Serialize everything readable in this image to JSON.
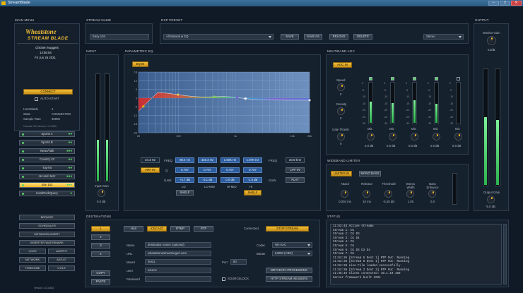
{
  "window": {
    "title": "StreamBlade",
    "minimize": "–",
    "maximize": "□",
    "close": "✕"
  },
  "main_menu": {
    "title": "MAIN MENU",
    "logo": "Wheatstone",
    "product": "STREAM BLADE",
    "station": "Chicken Nuggets",
    "time": "13:56:54",
    "date": "Fri Jun 25 2021",
    "connect_label": "CONNECT",
    "autostart_label": "AUTO-START",
    "host_label": "Host Blade",
    "host_value": "4",
    "state_label": "State",
    "state_value": "CONNECTED",
    "rate_label": "Sample Rate",
    "rate_value": "96000",
    "versions": "Console GUI Version 1.0.3.883",
    "sources": [
      {
        "label": "Sports A",
        "dots": "●●",
        "active": false
      },
      {
        "label": "Sports B",
        "dots": "●●",
        "active": false
      },
      {
        "label": "News/Talk",
        "dots": "●●●",
        "active": false
      },
      {
        "label": "Country 22",
        "dots": "●●",
        "active": false
      },
      {
        "label": "Top-hit",
        "dots": "●●",
        "active": false
      },
      {
        "label": "Jet and Jazz",
        "dots": "●●●",
        "active": false
      },
      {
        "label": "Site 103",
        "dots": "●●●",
        "active": true
      },
      {
        "label": "HardRockQuery",
        "dots": "●",
        "active": false
      }
    ],
    "buttons": [
      [
        "BROWSE"
      ],
      [
        "SCHEDULER"
      ],
      [
        "METADATA INSERT"
      ],
      [
        "INSERTER WATERMARK"
      ],
      [
        "LOGS",
        "ALERTS"
      ],
      [
        "NETWORK",
        "AES-67"
      ],
      [
        "TIMEZONE",
        "UTILS"
      ]
    ],
    "footer": "Version 1.0.3.883"
  },
  "stream_name": {
    "title": "STREAM NAME",
    "value": "Easy 103"
  },
  "dsp_preset": {
    "title": "DSP PRESET",
    "value": "All Natural w EQ",
    "save": "SAVE",
    "save_as": "SAVE AS",
    "reload": "RELOAD",
    "delete": "DELETE",
    "mode": "Stereo"
  },
  "output": {
    "title": "OUTPUT",
    "monitor_gain_label": "Monitor Gain",
    "monitor_gain_value": "-13dB",
    "output_gain_label": "Output Gain",
    "output_gain_value": "-5.0 dB",
    "level": 0.58
  },
  "input": {
    "title": "INPUT",
    "gain_label": "Input Gain",
    "gain_value": "0.0 dB",
    "level": 0.38
  },
  "eq": {
    "title": "PARAMETRIC EQ",
    "eq_in": "EQ IN",
    "db_ticks": [
      "18",
      "12",
      "6",
      "0",
      "-6",
      "-12",
      "-18",
      "-24"
    ],
    "freq_ticks": [
      "20",
      "100",
      "1k",
      "10k",
      "20k"
    ],
    "freq_label": "FREQ",
    "q_label": "Q",
    "gain_label": "GAIN",
    "hpf_label": "HPF IN",
    "lpf_label": "LPF IN",
    "flat_label": "FLAT",
    "hpf_freq": "24.3 Hz",
    "lpf_freq": "20.0 kHz",
    "bands": [
      {
        "name": "LO",
        "freq": "98.4 Hz",
        "q": "0.707",
        "gain": "+4.7 dB",
        "shelf": "SHELF"
      },
      {
        "name": "LO-MID",
        "freq": "426.3 Hz",
        "q": "0.707",
        "gain": "-0.1 dB"
      },
      {
        "name": "HI-MID",
        "freq": "1.50K Hz",
        "q": "0.707",
        "gain": "0.0 dB"
      },
      {
        "name": "HI",
        "freq": "1.07K Hz",
        "q": "0.707",
        "gain": "-1.5 dB",
        "shelf": "SHELF"
      }
    ]
  },
  "agc": {
    "title": "MULTIBAND AGC",
    "agc_in": "AGC IN",
    "knobs": [
      {
        "label": "Speed",
        "value": "0"
      },
      {
        "label": "Density",
        "value": "0"
      },
      {
        "label": "Gate Thresh",
        "value": "0"
      }
    ],
    "bands": [
      {
        "label": "Mix",
        "value": "0.0 dB",
        "level": 0.52
      },
      {
        "label": "Mix",
        "value": "0.0 dB",
        "level": 0.48
      },
      {
        "label": "Mix",
        "value": "0.0 dB",
        "level": 0.55
      },
      {
        "label": "Mix",
        "value": "0.0 dB",
        "level": 0.47
      },
      {
        "label": "Mix",
        "value": "0.0 dB",
        "level": 0.0
      }
    ],
    "scale": [
      "0",
      "-5",
      "-10",
      "-15",
      "-20",
      "-25",
      "-30"
    ]
  },
  "limiter": {
    "title": "WIDEBAND LIMITER",
    "limiter_in": "LIMITER IN",
    "mono_bass": "MONO BASS",
    "knobs": [
      {
        "label": "Attack",
        "value": "0.003 ms"
      },
      {
        "label": "Release",
        "value": "10 ms"
      },
      {
        "label": "Threshold",
        "value": "-6.25 dB"
      },
      {
        "label": "Stereo Width",
        "value": "1.00"
      },
      {
        "label": "Bass Enhance",
        "value": "0.0"
      }
    ]
  },
  "destinations": {
    "title": "DESTINATIONS",
    "slots": [
      "1",
      "2",
      "3",
      "4"
    ],
    "copy": "COPY",
    "paste": "PASTE",
    "protocols": [
      "HLS",
      "ICECAST",
      "RTMP",
      "RTP"
    ],
    "active_protocol": "ICECAST",
    "status": "Connected",
    "stop_stream": "STOP STREAM",
    "name_label": "Name",
    "name_value": "destination name (optional)",
    "url_label": "URL",
    "url_value": "wheatstonestreamingurl.com",
    "mount_label": "Mount",
    "mount_value": "/test1",
    "port_label": "Port",
    "port_value": "80",
    "user_label": "User",
    "user_value": "source",
    "password_label": "Password",
    "password_value": "",
    "codec_label": "Codec",
    "codec_value": "HE-AAC",
    "bitrate_label": "Bitrate",
    "bitrate_value": "64000 (CBR)",
    "sourcelock_label": "SOURCELOCK",
    "metadata_processing": "METADATA PROCESSING",
    "http_headers": "HTTP STREAM HEADERS"
  },
  "status": {
    "title": "STATUS",
    "lines": [
      "11:52:43  Active streams",
      "Stream 1: D1",
      "Stream 2: D1 D3",
      "Stream 3: D1 D4",
      "Stream 4: D1",
      "Stream 5: D1",
      "Stream 6: D1 D3 D3 D4",
      "Stream 7: D1",
      "11:52:35  [Stream 5 Dest 1]  RTP Out: Running",
      "11:52:36  [Stream 6 Dest 1]  RTP Out: Running",
      "11:52:36  Live File loaded successfully",
      "11:52:38  [Stream 2 Dest 3]  RTP Out: Running",
      "11:48:46  Client connected: 10.1.10.160",
      "Server framework built 2021"
    ]
  }
}
